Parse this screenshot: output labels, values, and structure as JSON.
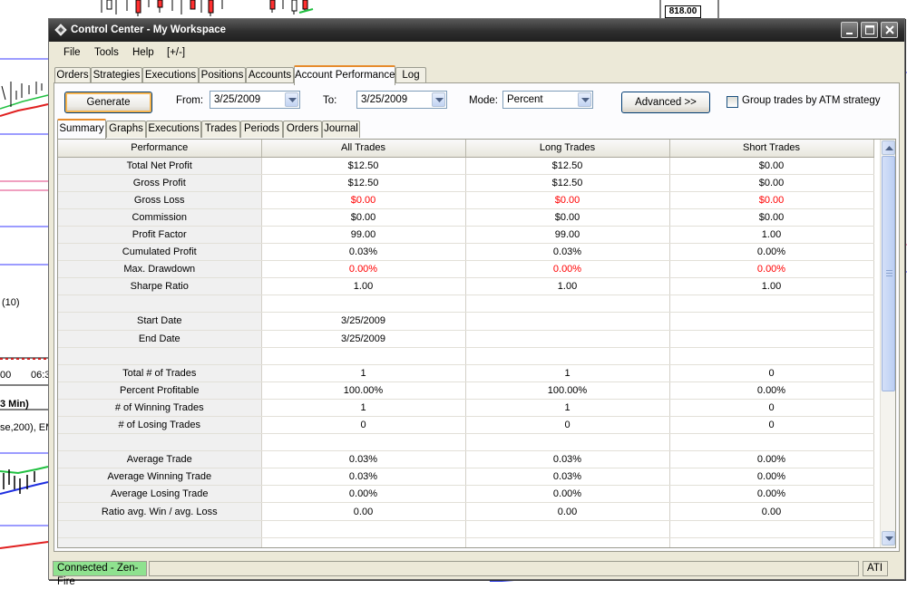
{
  "background": {
    "price_box": "818.00",
    "label_10": "(10)",
    "label_time_1": "00",
    "label_time_2": "06:3",
    "label_3min": "3 Min)",
    "label_ema": "se,200), EM"
  },
  "window": {
    "title": "Control Center - My Workspace",
    "colors": {
      "accent_tab": "#e68b2c",
      "negative": "#ff0000",
      "connected": "#8fe28f"
    }
  },
  "menu": [
    "File",
    "Tools",
    "Help",
    "[+/-]"
  ],
  "tabs": [
    "Orders",
    "Strategies",
    "Executions",
    "Positions",
    "Accounts",
    "Account Performance",
    "Log"
  ],
  "active_tab": "Account Performance",
  "controls": {
    "generate": "Generate",
    "from_label": "From:",
    "from_value": "3/25/2009",
    "to_label": "To:",
    "to_value": "3/25/2009",
    "mode_label": "Mode:",
    "mode_value": "Percent",
    "advanced": "Advanced >>",
    "group_label": "Group trades by ATM strategy",
    "group_checked": false
  },
  "subtabs": [
    "Summary",
    "Graphs",
    "Executions",
    "Trades",
    "Periods",
    "Orders",
    "Journal"
  ],
  "active_subtab": "Summary",
  "table": {
    "headers": [
      "Performance",
      "All Trades",
      "Long Trades",
      "Short Trades"
    ],
    "rows": [
      [
        "Total Net Profit",
        "$12.50",
        "$12.50",
        "$0.00"
      ],
      [
        "Gross Profit",
        "$12.50",
        "$12.50",
        "$0.00"
      ],
      [
        "Gross Loss",
        "$0.00",
        "$0.00",
        "$0.00"
      ],
      [
        "Commission",
        "$0.00",
        "$0.00",
        "$0.00"
      ],
      [
        "Profit Factor",
        "99.00",
        "99.00",
        "1.00"
      ],
      [
        "Cumulated Profit",
        "0.03%",
        "0.03%",
        "0.00%"
      ],
      [
        "Max. Drawdown",
        "0.00%",
        "0.00%",
        "0.00%"
      ],
      [
        "Sharpe Ratio",
        "1.00",
        "1.00",
        "1.00"
      ],
      [
        "",
        "",
        "",
        ""
      ],
      [
        "Start Date",
        "3/25/2009",
        "",
        ""
      ],
      [
        "End Date",
        "3/25/2009",
        "",
        ""
      ],
      [
        "",
        "",
        "",
        ""
      ],
      [
        "Total # of Trades",
        "1",
        "1",
        "0"
      ],
      [
        "Percent Profitable",
        "100.00%",
        "100.00%",
        "0.00%"
      ],
      [
        "# of Winning Trades",
        "1",
        "1",
        "0"
      ],
      [
        "# of Losing Trades",
        "0",
        "0",
        "0"
      ],
      [
        "",
        "",
        "",
        ""
      ],
      [
        "Average Trade",
        "0.03%",
        "0.03%",
        "0.00%"
      ],
      [
        "Average Winning Trade",
        "0.03%",
        "0.03%",
        "0.00%"
      ],
      [
        "Average Losing Trade",
        "0.00%",
        "0.00%",
        "0.00%"
      ],
      [
        "Ratio avg. Win / avg. Loss",
        "0.00",
        "0.00",
        "0.00"
      ],
      [
        "",
        "",
        "",
        ""
      ],
      [
        "",
        "",
        "",
        ""
      ]
    ],
    "negative_rows": [
      2,
      6
    ]
  },
  "status": {
    "connection": "Connected - Zen-Fire",
    "account": "ATI"
  }
}
